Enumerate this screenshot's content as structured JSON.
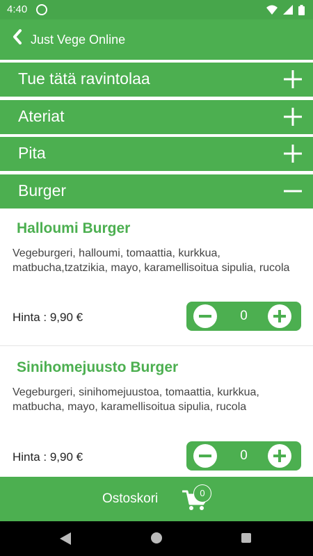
{
  "status_bar": {
    "time": "4:40",
    "icons": [
      "at-sign-icon",
      "wifi-icon",
      "signal-icon",
      "battery-icon"
    ]
  },
  "app_bar": {
    "title": "Just Vege Online",
    "back_icon": "chevron-left-icon"
  },
  "sections": [
    {
      "label": "Tue tätä ravintolaa",
      "state": "collapsed",
      "icon": "plus-icon"
    },
    {
      "label": "Ateriat",
      "state": "collapsed",
      "icon": "plus-icon"
    },
    {
      "label": "Pita",
      "state": "collapsed",
      "icon": "plus-icon"
    },
    {
      "label": "Burger",
      "state": "expanded",
      "icon": "minus-icon"
    }
  ],
  "items": [
    {
      "name": "Halloumi Burger",
      "desc": "Vegeburgeri, halloumi, tomaattia, kurkkua, matbucha,tzatzikia, mayo, karamellisoitua sipulia, rucola",
      "price": "Hinta : 9,90 €",
      "qty": "0"
    },
    {
      "name": "Sinihomejuusto Burger",
      "desc": "Vegeburgeri, sinihomejuustoa, tomaattia, kurkkua, matbucha, mayo, karamellisoitua sipulia, rucola",
      "price": "Hinta : 9,90 €",
      "qty": "0"
    }
  ],
  "cart": {
    "label": "Ostoskori",
    "count": "0",
    "icon": "shopping-cart-icon"
  },
  "colors": {
    "primary": "#4caf50",
    "status_bar": "#47a64b",
    "text": "#444444",
    "nav_bar": "#000000"
  }
}
